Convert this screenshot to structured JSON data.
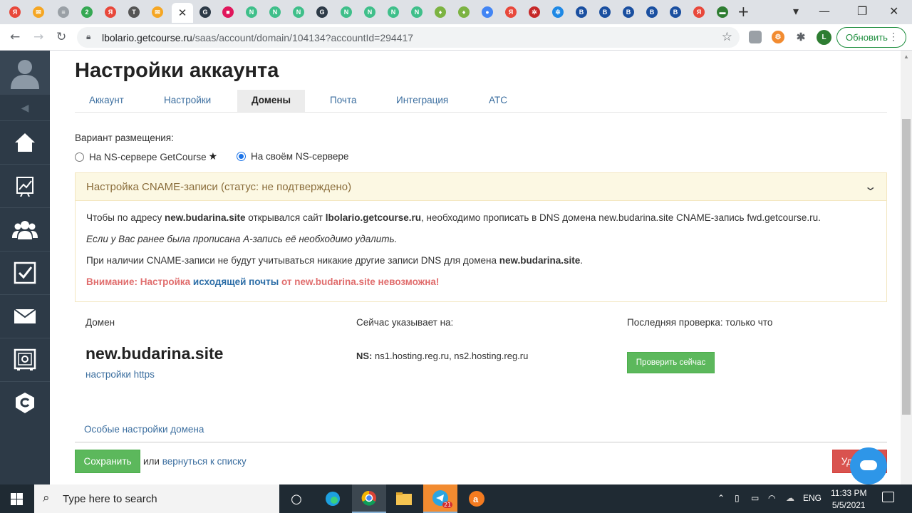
{
  "browser": {
    "tabs": [
      {
        "icon": "yandex-icon",
        "glyph": "Я",
        "color": "#e8483b"
      },
      {
        "icon": "mail-icon",
        "glyph": "✉",
        "color": "#f5a623"
      },
      {
        "icon": "doc-icon",
        "glyph": "≡",
        "color": "#9aa0a6"
      },
      {
        "icon": "two-icon",
        "glyph": "2",
        "color": "#35a853"
      },
      {
        "icon": "yandex-icon",
        "glyph": "Я",
        "color": "#e8483b"
      },
      {
        "icon": "t-icon",
        "glyph": "T",
        "color": "#555555"
      },
      {
        "icon": "mail-icon",
        "glyph": "✉",
        "color": "#f5a623"
      },
      {
        "icon": "gc-icon",
        "glyph": "G",
        "color": "#2d3a47"
      },
      {
        "icon": "shape-icon",
        "glyph": "■",
        "color": "#e0175c"
      },
      {
        "icon": "n-icon",
        "glyph": "N",
        "color": "#3fbf8a"
      },
      {
        "icon": "n-icon",
        "glyph": "N",
        "color": "#3fbf8a"
      },
      {
        "icon": "n-icon",
        "glyph": "N",
        "color": "#3fbf8a"
      },
      {
        "icon": "gc-icon",
        "glyph": "G",
        "color": "#2d3a47"
      },
      {
        "icon": "n-icon",
        "glyph": "N",
        "color": "#3fbf8a"
      },
      {
        "icon": "n-icon",
        "glyph": "N",
        "color": "#3fbf8a"
      },
      {
        "icon": "n-icon",
        "glyph": "N",
        "color": "#3fbf8a"
      },
      {
        "icon": "n-icon",
        "glyph": "N",
        "color": "#3fbf8a"
      },
      {
        "icon": "pin-icon",
        "glyph": "♦",
        "color": "#7cb342"
      },
      {
        "icon": "pin-icon",
        "glyph": "♦",
        "color": "#7cb342"
      },
      {
        "icon": "maps-icon",
        "glyph": "●",
        "color": "#4285f4"
      },
      {
        "icon": "yandex-icon",
        "glyph": "Я",
        "color": "#e8483b"
      },
      {
        "icon": "gear-icon",
        "glyph": "✲",
        "color": "#c62828"
      },
      {
        "icon": "gear-icon",
        "glyph": "✲",
        "color": "#1e88e5"
      },
      {
        "icon": "b-icon",
        "glyph": "B",
        "color": "#1a4fa0"
      },
      {
        "icon": "b-icon",
        "glyph": "B",
        "color": "#1a4fa0"
      },
      {
        "icon": "b-icon",
        "glyph": "B",
        "color": "#1a4fa0"
      },
      {
        "icon": "b-icon",
        "glyph": "B",
        "color": "#1a4fa0"
      },
      {
        "icon": "b-icon",
        "glyph": "B",
        "color": "#1a4fa0"
      },
      {
        "icon": "yandex-icon",
        "glyph": "Я",
        "color": "#e8483b"
      },
      {
        "icon": "card-icon",
        "glyph": "▬",
        "color": "#2e7d32"
      }
    ],
    "url_host": "lbolario.getcourse.ru",
    "url_path": "/saas/account/domain/104134?accountId=294417",
    "profile_initial": "L",
    "update_label": "Обновить"
  },
  "page": {
    "title": "Настройки аккаунта",
    "tabs": [
      "Аккаунт",
      "Настройки",
      "Домены",
      "Почта",
      "Интеграция",
      "АТС"
    ],
    "active_tab": "Домены",
    "placement_label": "Вариант размещения:",
    "option_gc": "На NS-сервере GetCourse",
    "option_own": "На своём NS-сервере",
    "selected_option": "На своём NS-сервере",
    "panel": {
      "title": "Настройка CNAME-записи (статус: не подтверждено)",
      "line1_a": "Чтобы по адресу ",
      "line1_domain": "new.budarina.site",
      "line1_b": " открывался сайт ",
      "line1_site": "lbolario.getcourse.ru",
      "line1_c": ", необходимо прописать в DNS домена new.budarina.site CNAME-запись fwd.getcourse.ru.",
      "line2": "Если у Вас ранее была прописана А-запись её необходимо удалить.",
      "line3_a": "При наличии CNAME-записи не будут учитываться никакие другие записи DNS для домена ",
      "line3_domain": "new.budarina.site",
      "line3_b": ".",
      "warn_a": "Внимание: Настройка ",
      "warn_link": "исходящей почты",
      "warn_b": " от new.budarina.site невозможна!"
    },
    "table": {
      "col_domain": "Домен",
      "col_points": "Сейчас указывает на:",
      "col_check": "Последняя проверка: только что",
      "domain": "new.budarina.site",
      "https_link": "настройки https",
      "ns_label": "NS:",
      "ns_value": " ns1.hosting.reg.ru, ns2.hosting.reg.ru",
      "check_button": "Проверить сейчас"
    },
    "special_link": "Особые настройки домена",
    "save_button": "Сохранить",
    "or_text": "или ",
    "back_link": "вернуться к списку",
    "delete_button": "Удалить"
  },
  "taskbar": {
    "search_placeholder": "Type here to search",
    "lang": "ENG",
    "time": "11:33 PM",
    "date": "5/5/2021",
    "telegram_badge": "21"
  },
  "colors": {
    "sidebar": "#2d3a47",
    "link": "#3b6e9f",
    "success": "#5cb85c",
    "danger": "#d9534f",
    "panel_bg": "#fcf8e3"
  }
}
